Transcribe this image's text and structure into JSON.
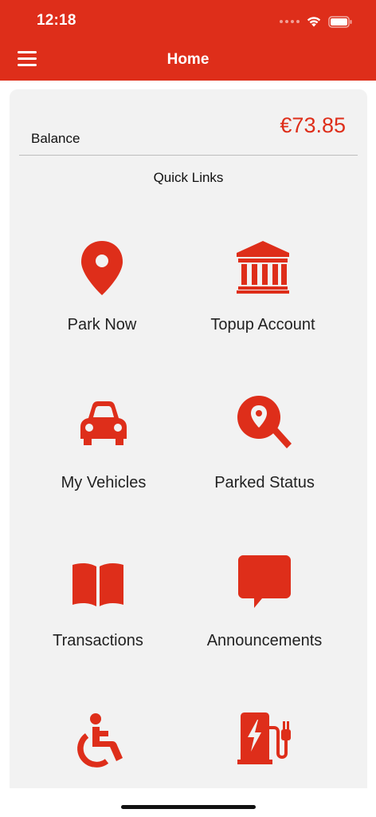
{
  "status": {
    "time": "12:18"
  },
  "header": {
    "title": "Home"
  },
  "balance": {
    "label": "Balance",
    "value": "€73.85"
  },
  "quick_links": {
    "title": "Quick Links",
    "items": [
      {
        "label": "Park Now",
        "icon": "map-pin-icon"
      },
      {
        "label": "Topup Account",
        "icon": "bank-icon"
      },
      {
        "label": "My Vehicles",
        "icon": "car-icon"
      },
      {
        "label": "Parked Status",
        "icon": "location-search-icon"
      },
      {
        "label": "Transactions",
        "icon": "book-icon"
      },
      {
        "label": "Announcements",
        "icon": "chat-bubble-icon"
      },
      {
        "label": "",
        "icon": "wheelchair-icon"
      },
      {
        "label": "",
        "icon": "ev-charger-icon"
      }
    ]
  },
  "colors": {
    "accent": "#DE2E1A",
    "card_bg": "#F2F2F2"
  }
}
